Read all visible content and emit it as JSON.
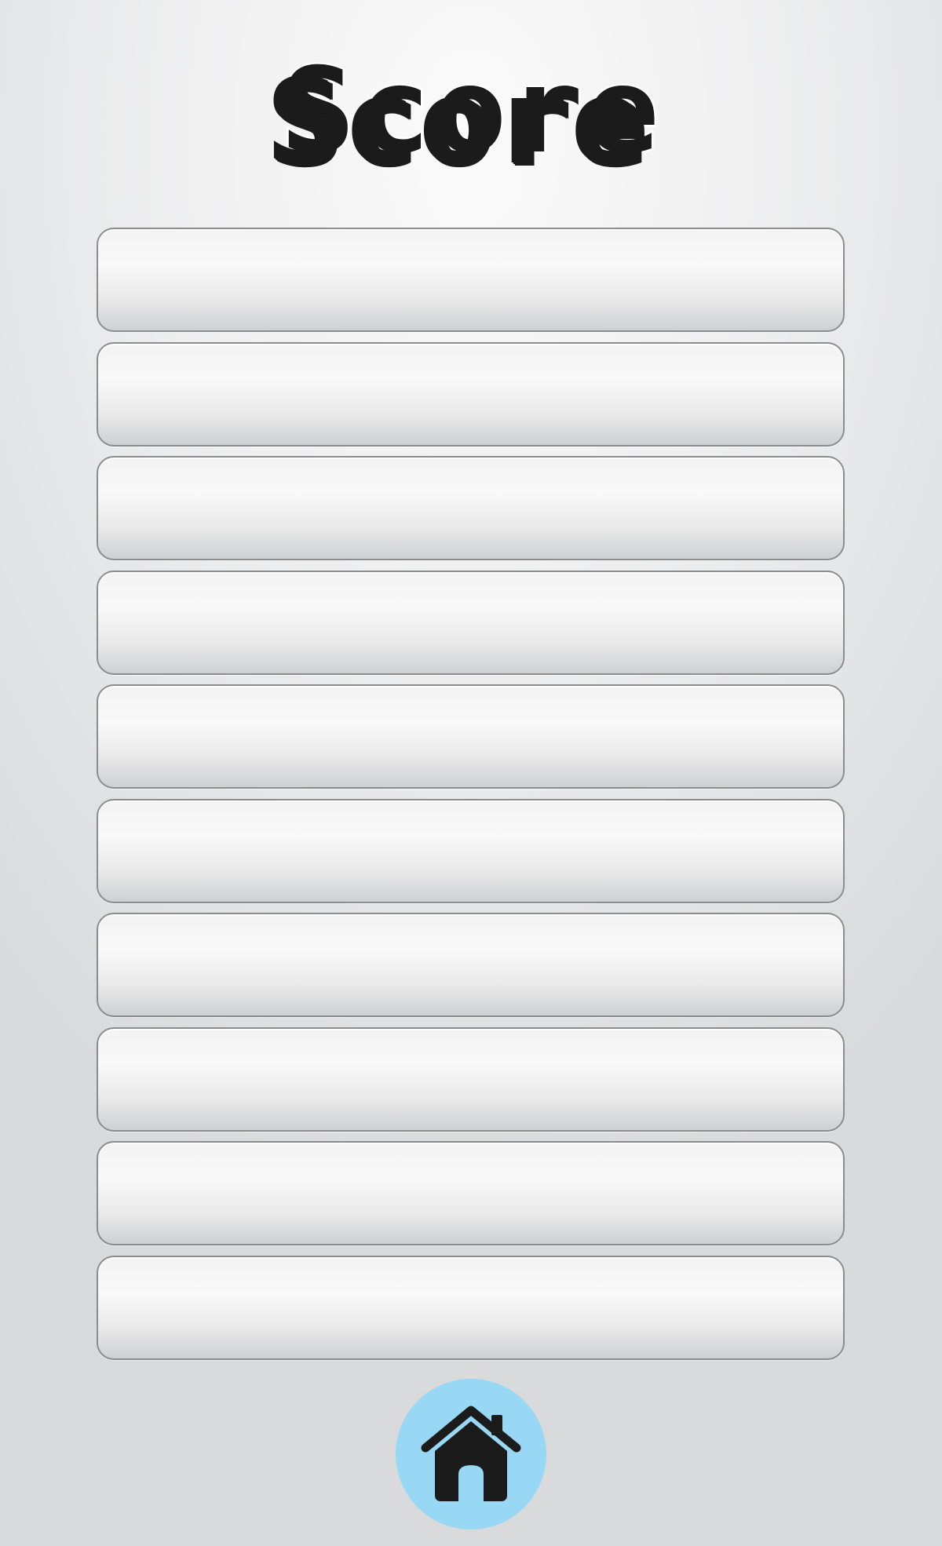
{
  "title": "Score",
  "scores": [
    {
      "name": "",
      "value": ""
    },
    {
      "name": "",
      "value": ""
    },
    {
      "name": "",
      "value": ""
    },
    {
      "name": "",
      "value": ""
    },
    {
      "name": "",
      "value": ""
    },
    {
      "name": "",
      "value": ""
    },
    {
      "name": "",
      "value": ""
    },
    {
      "name": "",
      "value": ""
    },
    {
      "name": "",
      "value": ""
    },
    {
      "name": "",
      "value": ""
    }
  ],
  "home_button": {
    "icon": "home-icon"
  },
  "colors": {
    "home_button_bg": "#99d8f4",
    "icon_fg": "#1b1b1b",
    "row_border": "#8c8c8c"
  }
}
